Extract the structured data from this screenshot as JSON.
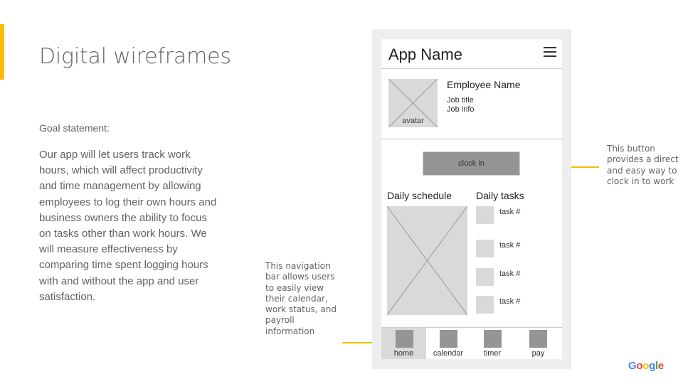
{
  "slide": {
    "title": "Digital wireframes",
    "goal_label": "Goal statement:",
    "goal_text": "Our app will let users track work hours, which will affect productivity and time management by allowing employees to log their own hours and business owners the ability to focus on tasks other than work hours. We will measure effectiveness by comparing time spent logging hours with and without the app and user satisfaction.",
    "accent_color": "#fbbc04"
  },
  "annotations": {
    "nav_note": "This navigation bar allows users to easily view their calendar, work status, and payroll information",
    "clock_note": "This button provides a direct and easy way to clock in to work"
  },
  "wireframe": {
    "header": {
      "app_name": "App Name",
      "menu_icon": "hamburger-menu-icon"
    },
    "profile": {
      "avatar_label": "avatar",
      "employee_name": "Employee Name",
      "job_title": "Job title",
      "job_info": "Job info"
    },
    "clock_in_label": "clock in",
    "schedule_title": "Daily schedule",
    "tasks_title": "Daily tasks",
    "tasks": [
      {
        "label": "task #"
      },
      {
        "label": "task #"
      },
      {
        "label": "task #"
      },
      {
        "label": "task #"
      }
    ],
    "nav": [
      {
        "label": "home",
        "active": true
      },
      {
        "label": "calendar",
        "active": false
      },
      {
        "label": "timer",
        "active": false
      },
      {
        "label": "pay",
        "active": false
      }
    ]
  },
  "footer": {
    "logo_letters": [
      {
        "ch": "G",
        "color": "#4285f4"
      },
      {
        "ch": "o",
        "color": "#ea4335"
      },
      {
        "ch": "o",
        "color": "#fbbc04"
      },
      {
        "ch": "g",
        "color": "#4285f4"
      },
      {
        "ch": "l",
        "color": "#34a853"
      },
      {
        "ch": "e",
        "color": "#ea4335"
      }
    ]
  }
}
